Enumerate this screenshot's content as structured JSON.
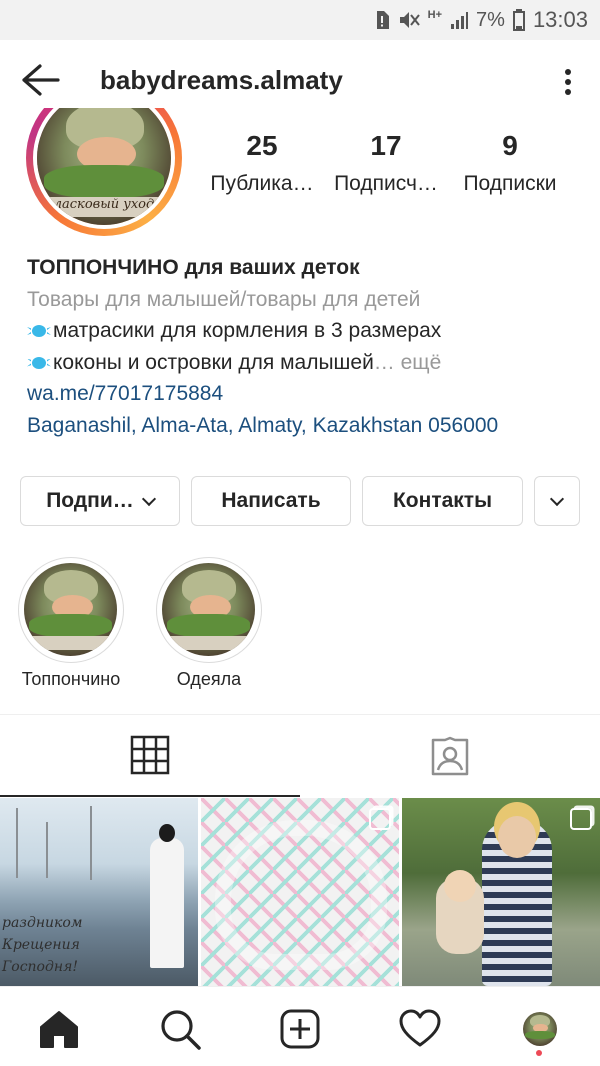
{
  "status_bar": {
    "battery": "7%",
    "time": "13:03",
    "network": "H+"
  },
  "header": {
    "username": "babydreams.almaty"
  },
  "stats": [
    {
      "value": "25",
      "label": "Публика…"
    },
    {
      "value": "17",
      "label": "Подписч…"
    },
    {
      "value": "9",
      "label": "Подписки"
    }
  ],
  "avatar": {
    "caption": "ласковый уход"
  },
  "bio": {
    "name": "ТОППОНЧИНО для ваших деток",
    "category": "Товары для малышей/товары для детей",
    "line1": "матрасики для кормления в 3 размерах",
    "line2": "коконы и островки для малышей",
    "more": "… ещё",
    "link": "wa.me/77017175884",
    "address": "Baganashil, Alma-Ata, Almaty, Kazakhstan 056000"
  },
  "actions": {
    "follow": "Подпи…",
    "message": "Написать",
    "contacts": "Контакты"
  },
  "highlights": [
    {
      "label": "Топпончино"
    },
    {
      "label": "Одеяла"
    }
  ],
  "posts": [
    {
      "overlay_text": "раздником\nКрещения\nГосподня!"
    },
    {
      "overlay_text": ""
    },
    {
      "overlay_text": ""
    }
  ],
  "colors": {
    "link": "#1c4f7e",
    "muted": "#999999",
    "notification_dot": "#ed4956"
  }
}
